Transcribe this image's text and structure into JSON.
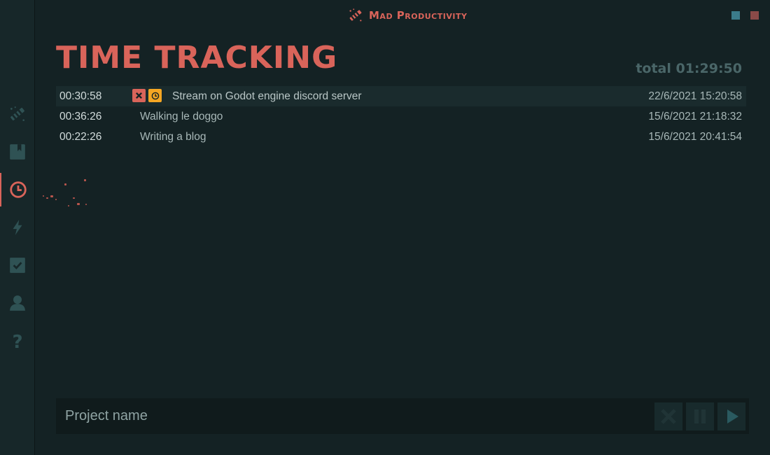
{
  "app": {
    "brand": "Mad Productivity",
    "colors": {
      "accent": "#d9645a",
      "background": "#142224",
      "sidebar": "#172729",
      "icon": "#2f5254",
      "resume": "#f5a623",
      "window_minimize": "#3b7b8a",
      "window_close": "#8a4a48"
    }
  },
  "sidebar": {
    "items": [
      {
        "icon": "wand-icon",
        "active": false
      },
      {
        "icon": "notebook-icon",
        "active": false
      },
      {
        "icon": "clock-icon",
        "active": true
      },
      {
        "icon": "lightning-icon",
        "active": false
      },
      {
        "icon": "checkbox-icon",
        "active": false
      },
      {
        "icon": "user-icon",
        "active": false
      },
      {
        "icon": "help-icon",
        "active": false
      }
    ]
  },
  "page": {
    "title": "TIME TRACKING",
    "total": "total 01:29:50"
  },
  "entries": [
    {
      "duration": "00:30:58",
      "name": "Stream on Godot engine discord server",
      "date": "22/6/2021 15:20:58",
      "active": true
    },
    {
      "duration": "00:36:26",
      "name": "Walking le doggo",
      "date": "15/6/2021 21:18:32",
      "active": false
    },
    {
      "duration": "00:22:26",
      "name": "Writing a blog",
      "date": "15/6/2021 20:41:54",
      "active": false
    }
  ],
  "footer": {
    "project_placeholder": "Project name"
  }
}
